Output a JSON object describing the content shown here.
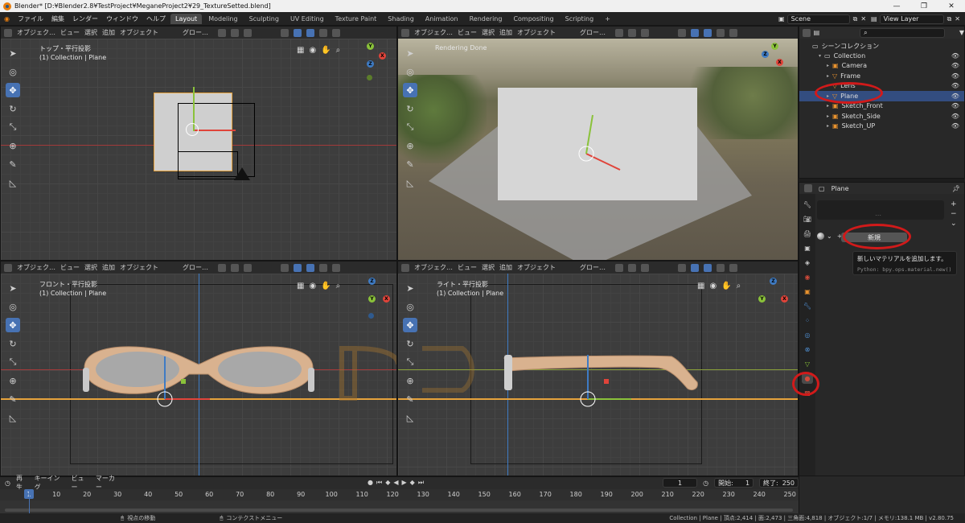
{
  "window": {
    "title": "Blender* [D:¥Blender2.8¥TestProject¥MeganeProject2¥29_TextureSetted.blend]",
    "minimize": "—",
    "maximize": "❐",
    "close": "✕"
  },
  "menu": {
    "items": [
      "ファイル",
      "編集",
      "レンダー",
      "ウィンドウ",
      "ヘルプ"
    ],
    "tabs": [
      "Layout",
      "Modeling",
      "Sculpting",
      "UV Editing",
      "Texture Paint",
      "Shading",
      "Animation",
      "Rendering",
      "Compositing",
      "Scripting"
    ],
    "active_tab": "Layout",
    "add_tab": "+",
    "scene": "Scene",
    "view_layer": "View Layer"
  },
  "viewport_header": {
    "mode": "オブジェク…",
    "view": "ビュー",
    "select": "選択",
    "add": "追加",
    "object": "オブジェクト",
    "transform": "グロー…"
  },
  "viewports": {
    "top": {
      "line1": "トップ・平行投影",
      "line2": "(1) Collection | Plane"
    },
    "render": {
      "line1": "Rendering Done"
    },
    "front": {
      "line1": "フロント・平行投影",
      "line2": "(1) Collection | Plane"
    },
    "right": {
      "line1": "ライト・平行投影",
      "line2": "(1) Collection | Plane"
    }
  },
  "gizmo": {
    "x": "X",
    "y": "Y",
    "z": "Z"
  },
  "outliner": {
    "search_placeholder": "",
    "root": "シーンコレクション",
    "items": [
      {
        "name": "Collection",
        "icon": "collection-icon"
      },
      {
        "name": "Camera",
        "icon": "camera-icon"
      },
      {
        "name": "Frame",
        "icon": "mesh-icon"
      },
      {
        "name": "Lens",
        "icon": "mesh-icon"
      },
      {
        "name": "Plane",
        "icon": "mesh-icon",
        "selected": true
      },
      {
        "name": "Sketch_Front",
        "icon": "image-icon"
      },
      {
        "name": "Sketch_Side",
        "icon": "image-icon"
      },
      {
        "name": "Sketch_UP",
        "icon": "image-icon"
      }
    ]
  },
  "properties": {
    "object_name": "Plane",
    "new_button": "新規",
    "tooltip_title": "新しいマテリアルを追加します。",
    "tooltip_python": "Python: bpy.ops.material.new()",
    "slot_dots": "⋯"
  },
  "timeline": {
    "playback": "再生",
    "keying": "キーイング",
    "view": "ビュー",
    "marker": "マーカー",
    "current_frame": "1",
    "start_label": "開始:",
    "start": "1",
    "end_label": "終了:",
    "end": "250",
    "ruler": [
      "1",
      "10",
      "20",
      "30",
      "40",
      "50",
      "60",
      "70",
      "80",
      "90",
      "100",
      "110",
      "120",
      "130",
      "140",
      "150",
      "160",
      "170",
      "180",
      "190",
      "200",
      "210",
      "220",
      "230",
      "240",
      "250"
    ]
  },
  "status": {
    "left_hint": "視点の移動",
    "middle_hint": "コンテクストメニュー",
    "right": "Collection | Plane | 頂点:2,414 | 面:2,473 | 三角面:4,818 | オブジェクト:1/7 | メモリ:138.1 MB | v2.80.75"
  },
  "colors": {
    "accent": "#4772b3",
    "selection": "#334d80",
    "annotation": "#d11a1a",
    "x_axis": "#e0443a",
    "y_axis": "#8ac23a",
    "z_axis": "#3e7bc4"
  }
}
